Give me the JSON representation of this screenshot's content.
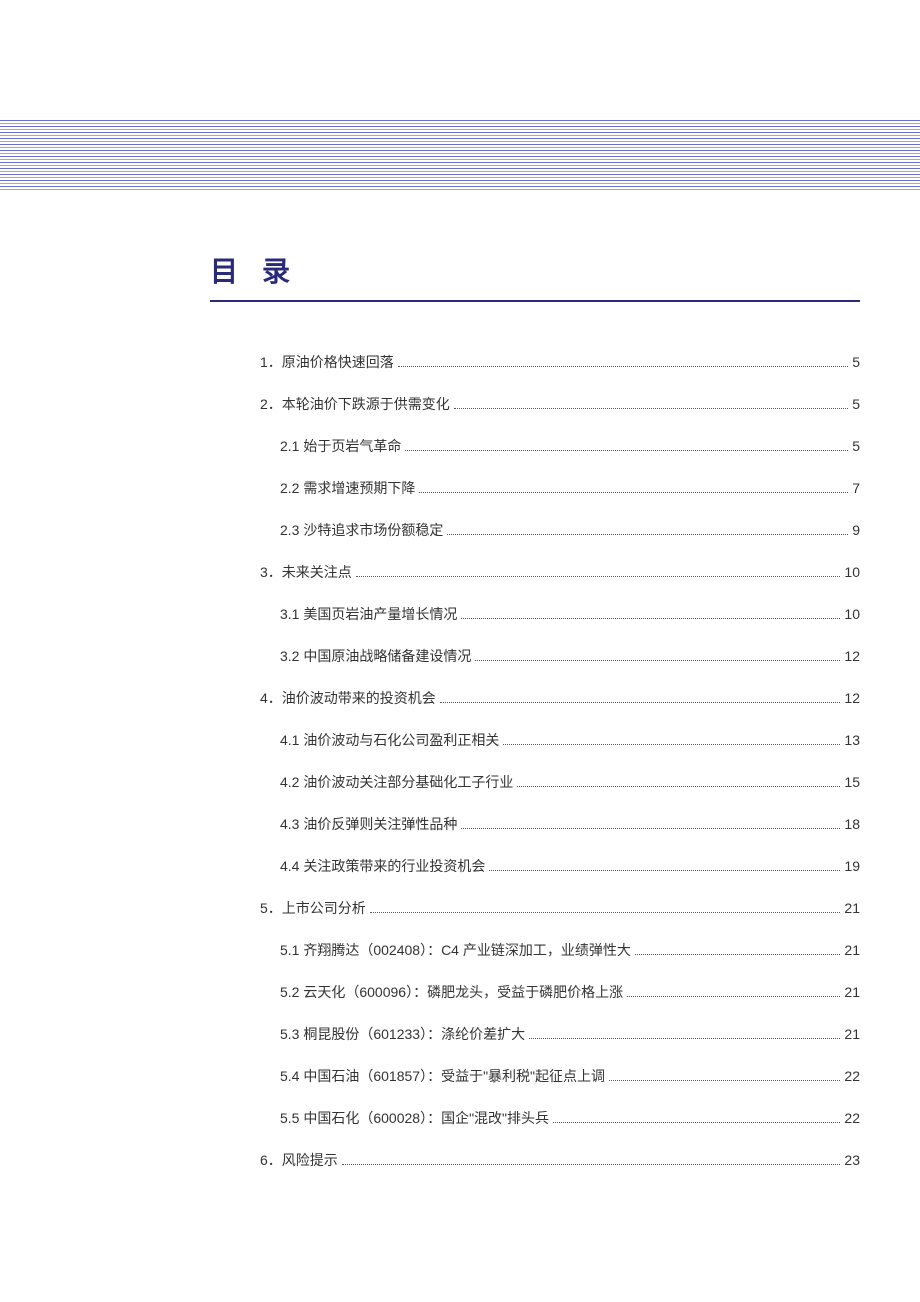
{
  "title": "目录",
  "toc": [
    {
      "level": 1,
      "label": "1．原油价格快速回落",
      "page": "5"
    },
    {
      "level": 1,
      "label": "2．本轮油价下跌源于供需变化",
      "page": "5"
    },
    {
      "level": 2,
      "label": "2.1 始于页岩气革命",
      "page": "5"
    },
    {
      "level": 2,
      "label": "2.2 需求增速预期下降",
      "page": "7"
    },
    {
      "level": 2,
      "label": "2.3 沙特追求市场份额稳定",
      "page": "9"
    },
    {
      "level": 1,
      "label": "3．未来关注点",
      "page": "10"
    },
    {
      "level": 2,
      "label": "3.1 美国页岩油产量增长情况",
      "page": "10"
    },
    {
      "level": 2,
      "label": "3.2 中国原油战略储备建设情况",
      "page": "12"
    },
    {
      "level": 1,
      "label": "4．油价波动带来的投资机会",
      "page": "12"
    },
    {
      "level": 2,
      "label": "4.1 油价波动与石化公司盈利正相关",
      "page": "13"
    },
    {
      "level": 2,
      "label": "4.2 油价波动关注部分基础化工子行业",
      "page": "15"
    },
    {
      "level": 2,
      "label": "4.3 油价反弹则关注弹性品种",
      "page": "18"
    },
    {
      "level": 2,
      "label": "4.4 关注政策带来的行业投资机会",
      "page": "19"
    },
    {
      "level": 1,
      "label": "5．上市公司分析",
      "page": "21"
    },
    {
      "level": 2,
      "label": "5.1 齐翔腾达（002408）：C4 产业链深加工，业绩弹性大",
      "page": "21"
    },
    {
      "level": 2,
      "label": "5.2 云天化（600096）：磷肥龙头，受益于磷肥价格上涨",
      "page": "21"
    },
    {
      "level": 2,
      "label": "5.3 桐昆股份（601233）：涤纶价差扩大",
      "page": "21"
    },
    {
      "level": 2,
      "label": "5.4 中国石油（601857）：受益于\"暴利税\"起征点上调",
      "page": "22"
    },
    {
      "level": 2,
      "label": "5.5 中国石化（600028）：国企\"混改\"排头兵",
      "page": "22"
    },
    {
      "level": 1,
      "label": "6．风险提示",
      "page": "23"
    }
  ]
}
